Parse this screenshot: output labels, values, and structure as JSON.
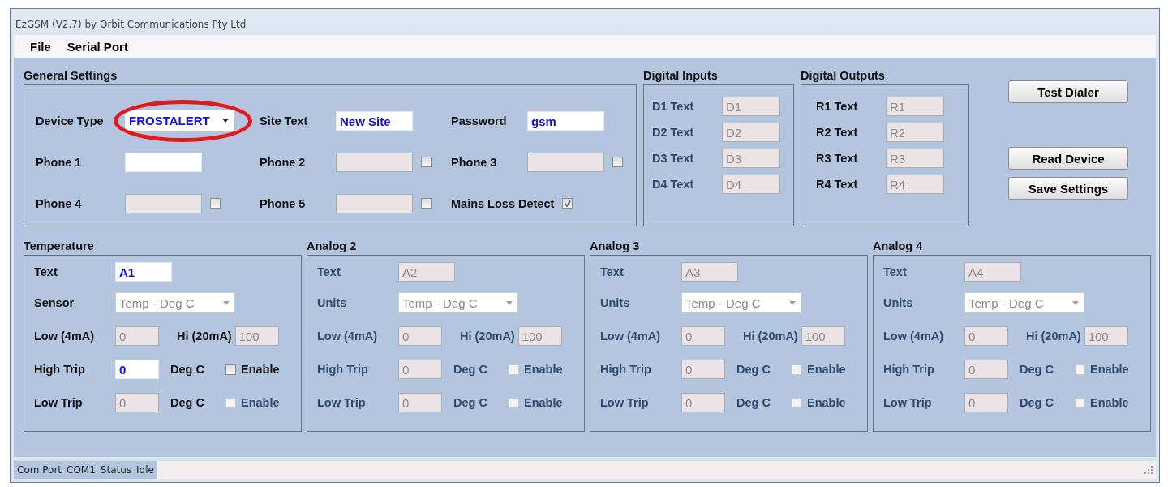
{
  "window": {
    "title": "EzGSM (V2.7) by Orbit Communications Pty Ltd"
  },
  "menu": [
    {
      "label": "File"
    },
    {
      "label": "Serial Port"
    }
  ],
  "general_settings": {
    "title": "General Settings",
    "fields": [
      {
        "kind": "dropdown",
        "label": "Device Type",
        "value": "FROSTALERT",
        "disabled": false,
        "circled": true
      },
      {
        "kind": "text",
        "label": "Site Text",
        "value": "New Site",
        "disabled": false
      },
      {
        "kind": "text",
        "label": "Password",
        "value": "gsm",
        "disabled": false
      },
      {
        "kind": "text",
        "label": "Phone 1",
        "disabled": false
      },
      {
        "kind": "text",
        "label": "Phone  2",
        "disabled": true,
        "checked": false
      },
      {
        "kind": "text",
        "label": "Phone 3",
        "disabled": true,
        "checked": false
      },
      {
        "kind": "text",
        "label": "Phone 4",
        "disabled": true,
        "checked": false
      },
      {
        "kind": "text",
        "label": "Phone 5",
        "disabled": true,
        "checked": false
      },
      {
        "kind": "checkbox",
        "label": "Mains Loss Detect",
        "checked": true
      }
    ]
  },
  "digital_inputs": {
    "title": "Digital Inputs",
    "disabled": true,
    "rows": [
      {
        "label": "D1 Text",
        "value": "D1"
      },
      {
        "label": "D2 Text",
        "value": "D2"
      },
      {
        "label": "D3 Text",
        "value": "D3"
      },
      {
        "label": "D4 Text",
        "value": "D4"
      }
    ]
  },
  "digital_outputs": {
    "title": "Digital Outputs",
    "disabled": false,
    "rows": [
      {
        "label": "R1 Text",
        "value": "R1"
      },
      {
        "label": "R2 Text",
        "value": "R2"
      },
      {
        "label": "R3 Text",
        "value": "R3"
      },
      {
        "label": "R4 Text",
        "value": "R4"
      }
    ]
  },
  "buttons": [
    {
      "label": "Test Dialer"
    },
    {
      "label": "Read Device"
    },
    {
      "label": "Save Settings"
    }
  ],
  "analog_panels": [
    {
      "title": "Temperature",
      "disabled": false,
      "text": {
        "label": "Text",
        "value": "A1",
        "disabled": false
      },
      "units": {
        "label": "Sensor",
        "value": "Temp - Deg C"
      },
      "low": {
        "label": "Low (4mA)",
        "value": "0"
      },
      "hi": {
        "label": "Hi (20mA)",
        "value": "100"
      },
      "trips": [
        {
          "label": "High Trip",
          "value": "0",
          "disabled": false,
          "unit": "Deg C",
          "check_label": "Enable",
          "checked": false,
          "check_disabled": false
        },
        {
          "label": "Low Trip",
          "value": "0",
          "disabled": true,
          "unit": "Deg C",
          "check_label": "Enable",
          "checked": false,
          "check_disabled": true
        }
      ]
    },
    {
      "title": "Analog 2",
      "disabled": true,
      "text": {
        "label": "Text",
        "value": "A2",
        "disabled": true
      },
      "units": {
        "label": "Units",
        "value": "Temp - Deg C"
      },
      "low": {
        "label": "Low (4mA)",
        "value": "0"
      },
      "hi": {
        "label": "Hi (20mA)",
        "value": "100"
      },
      "trips": [
        {
          "label": "High Trip",
          "value": "0",
          "disabled": true,
          "unit": "Deg C",
          "check_label": "Enable",
          "checked": false,
          "check_disabled": true
        },
        {
          "label": "Low Trip",
          "value": "0",
          "disabled": true,
          "unit": "Deg C",
          "check_label": "Enable",
          "checked": false,
          "check_disabled": true
        }
      ]
    },
    {
      "title": "Analog 3",
      "disabled": true,
      "text": {
        "label": "Text",
        "value": "A3",
        "disabled": true
      },
      "units": {
        "label": "Units",
        "value": "Temp - Deg C"
      },
      "low": {
        "label": "Low (4mA)",
        "value": "0"
      },
      "hi": {
        "label": "Hi (20mA)",
        "value": "100"
      },
      "trips": [
        {
          "label": "High Trip",
          "value": "0",
          "disabled": true,
          "unit": "Deg C",
          "check_label": "Enable",
          "checked": false,
          "check_disabled": true
        },
        {
          "label": "Low Trip",
          "value": "0",
          "disabled": true,
          "unit": "Deg C",
          "check_label": "Enable",
          "checked": false,
          "check_disabled": true
        }
      ]
    },
    {
      "title": "Analog 4",
      "disabled": true,
      "text": {
        "label": "Text",
        "value": "A4",
        "disabled": true
      },
      "units": {
        "label": "Units",
        "value": "Temp - Deg C"
      },
      "low": {
        "label": "Low (4mA)",
        "value": "0"
      },
      "hi": {
        "label": "Hi (20mA)",
        "value": "100"
      },
      "trips": [
        {
          "label": "High Trip",
          "value": "0",
          "disabled": true,
          "unit": "Deg C",
          "check_label": "Enable",
          "checked": false,
          "check_disabled": true
        },
        {
          "label": "Low Trip",
          "value": "0",
          "disabled": true,
          "unit": "Deg C",
          "check_label": "Enable",
          "checked": false,
          "check_disabled": true
        }
      ]
    }
  ],
  "status_bar": [
    {
      "text": "Com Port"
    },
    {
      "text": "COM1"
    },
    {
      "text": "Status"
    },
    {
      "text": "Idle"
    }
  ]
}
